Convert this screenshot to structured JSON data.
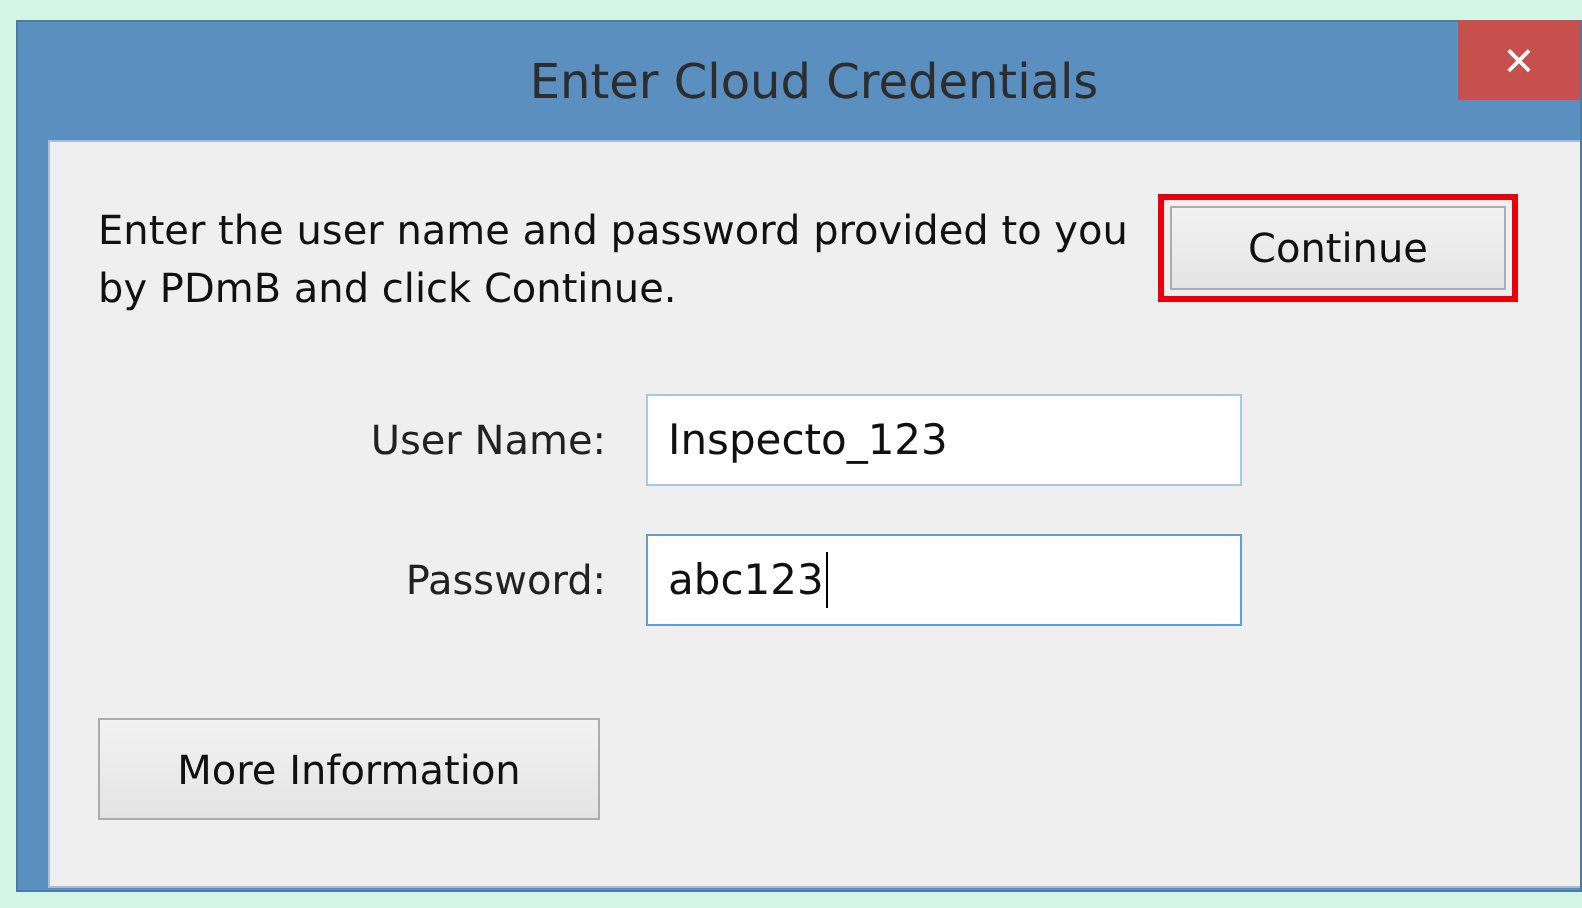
{
  "window": {
    "title": "Enter Cloud Credentials",
    "close_label": "×"
  },
  "instructions": "Enter the user name and password provided to you by PDmB and click Continue.",
  "continue_button": {
    "label": "Continue",
    "highlighted": true
  },
  "fields": [
    {
      "label": "User Name:",
      "value": "Inspecto_123",
      "focused": false
    },
    {
      "label": "Password:",
      "value": "abc123",
      "focused": true
    }
  ],
  "more_button": {
    "label": "More Information"
  }
}
